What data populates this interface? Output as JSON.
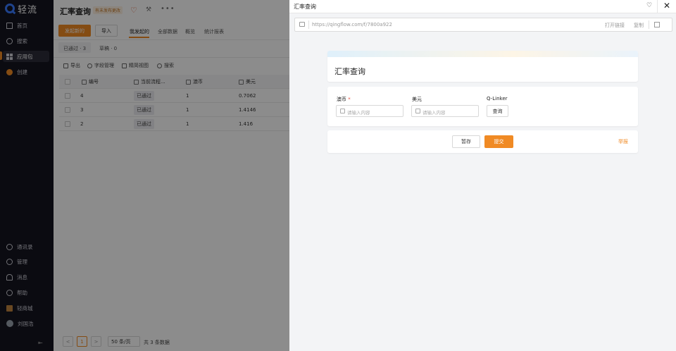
{
  "nav": {
    "logo_text": "轻流",
    "items": [
      {
        "label": "首页",
        "icon": "home-icon"
      },
      {
        "label": "搜索",
        "icon": "search-icon"
      },
      {
        "label": "应用包",
        "icon": "apps-icon"
      },
      {
        "label": "创建",
        "icon": "create-icon"
      }
    ],
    "bottom_items": [
      {
        "label": "通讯录",
        "icon": "contacts-icon"
      },
      {
        "label": "管理",
        "icon": "manage-icon"
      },
      {
        "label": "消息",
        "icon": "bell-icon"
      },
      {
        "label": "帮助",
        "icon": "help-icon"
      },
      {
        "label": "轻商城",
        "icon": "shop-icon"
      },
      {
        "label": "刘国浩",
        "icon": "avatar-icon"
      }
    ],
    "collapse": "⇤"
  },
  "app": {
    "title": "汇率查询",
    "unpublished_badge": "有未发布更改",
    "primary_button": "发起新的",
    "import_button": "导入",
    "view_tabs": [
      "我发起的",
      "全部数据",
      "概览",
      "统计报表"
    ],
    "status_tabs": [
      "已通过 · 3",
      "草稿 · 0"
    ],
    "toolbar": [
      "导出",
      "字段管理",
      "精简视图",
      "搜索"
    ],
    "table": {
      "columns": [
        "编号",
        "当前流程...",
        "澳币",
        "美元"
      ],
      "rows": [
        {
          "id": "4",
          "status": "已通过",
          "aud": "1",
          "usd": "0.7062"
        },
        {
          "id": "3",
          "status": "已通过",
          "aud": "1",
          "usd": "1.4146"
        },
        {
          "id": "2",
          "status": "已通过",
          "aud": "1",
          "usd": "1.416"
        }
      ]
    },
    "pagination": {
      "prev": "<",
      "current": "1",
      "next": ">",
      "page_size": "50 条/页",
      "total": "共 3 条数据"
    }
  },
  "drawer": {
    "title": "汇率查询",
    "url": "https://qingflow.com/f/7800a922",
    "open_link": "打开链接",
    "copy": "复制",
    "form_title": "汇率查询",
    "fields": [
      {
        "label": "澳币",
        "required": "*",
        "placeholder": "请输入内容"
      },
      {
        "label": "美元",
        "required": "",
        "placeholder": "请输入内容"
      },
      {
        "label": "Q-Linker",
        "required": "",
        "button": "查询"
      }
    ],
    "save_draft": "暂存",
    "submit": "提交",
    "report": "举报"
  }
}
